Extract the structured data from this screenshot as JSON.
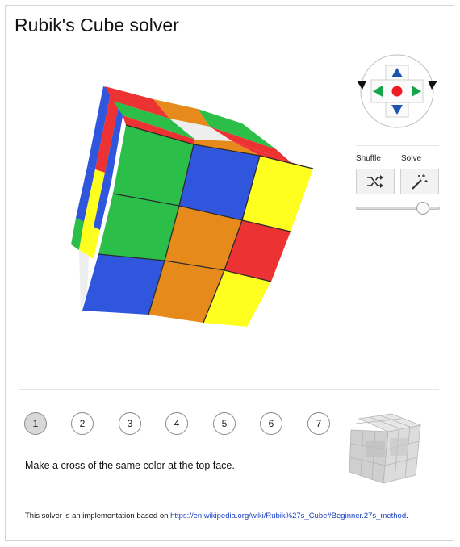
{
  "title": "Rubik's Cube solver",
  "controls": {
    "shuffle_label": "Shuffle",
    "solve_label": "Solve",
    "speed_slider_value_percent": 80
  },
  "steps": {
    "items": [
      "1",
      "2",
      "3",
      "4",
      "5",
      "6",
      "7"
    ],
    "active_index": 0,
    "instruction": "Make a cross of the same color at the top face."
  },
  "footer": {
    "prefix": "This solver is an implementation based on ",
    "link_text": "https://en.wikipedia.org/wiki/Rubik%27s_Cube#Beginner.27s_method",
    "suffix": "."
  },
  "colors": {
    "green": "#2bbf4a",
    "blue": "#2f56dc",
    "yellow": "#ffff1f",
    "orange": "#e68a1c",
    "red": "#ec3232",
    "white": "#eeeeee",
    "dpad_blue": "#1a56b0",
    "dpad_green": "#17a54b",
    "dpad_red": "#ee1c24"
  },
  "icons": {
    "dpad": "rotate-arrows-icon",
    "shuffle": "shuffle-icon",
    "solve": "magic-wand-icon"
  }
}
